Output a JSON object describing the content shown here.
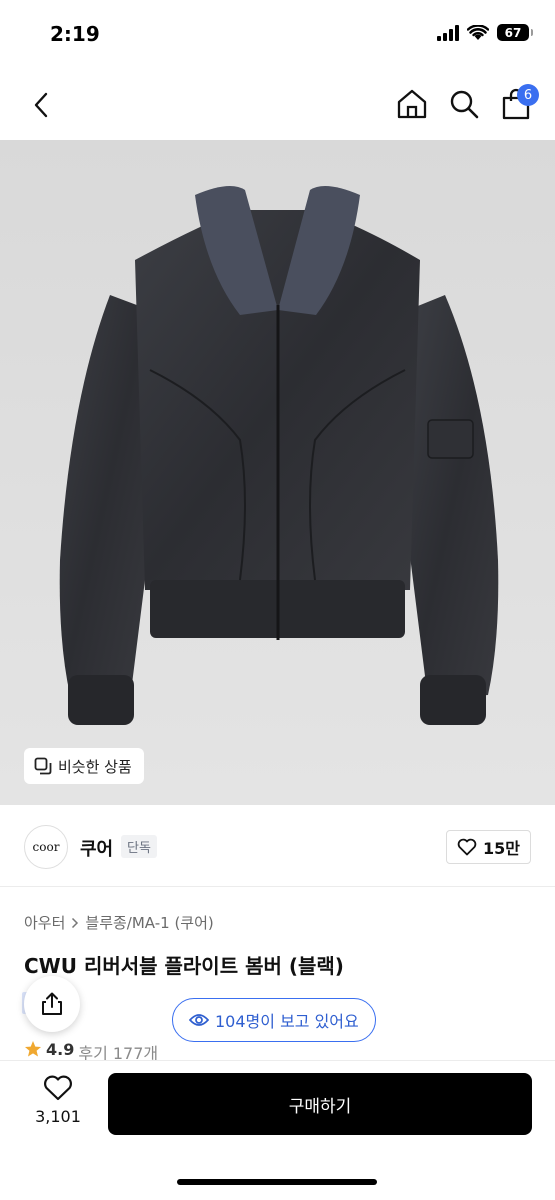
{
  "status_bar": {
    "time": "2:19",
    "battery": "67"
  },
  "nav": {
    "cart_count": "6"
  },
  "product_image": {
    "similar_label": "비슷한 상품"
  },
  "brand": {
    "logo_text": "coor",
    "name": "쿠어",
    "tag": "단독",
    "likes": "15만"
  },
  "breadcrumb": {
    "items": [
      "아우터",
      "블루종/MA-1 (쿠어)"
    ]
  },
  "product": {
    "title": "CWU 리버서블 플라이트 봄버 (블랙)"
  },
  "viewers": {
    "label": "104명이 보고 있어요"
  },
  "rating": {
    "value": "4.9",
    "reviews": "후기 177개"
  },
  "bottom": {
    "wish_count": "3,101",
    "buy_label": "구매하기"
  },
  "colors": {
    "accent": "#3a6ff0",
    "buy_button": "#000000",
    "star": "#f0a830"
  },
  "icons": [
    "back-icon",
    "home-icon",
    "search-icon",
    "cart-icon",
    "similar-icon",
    "heart-icon",
    "share-icon",
    "eye-icon",
    "star-icon"
  ]
}
